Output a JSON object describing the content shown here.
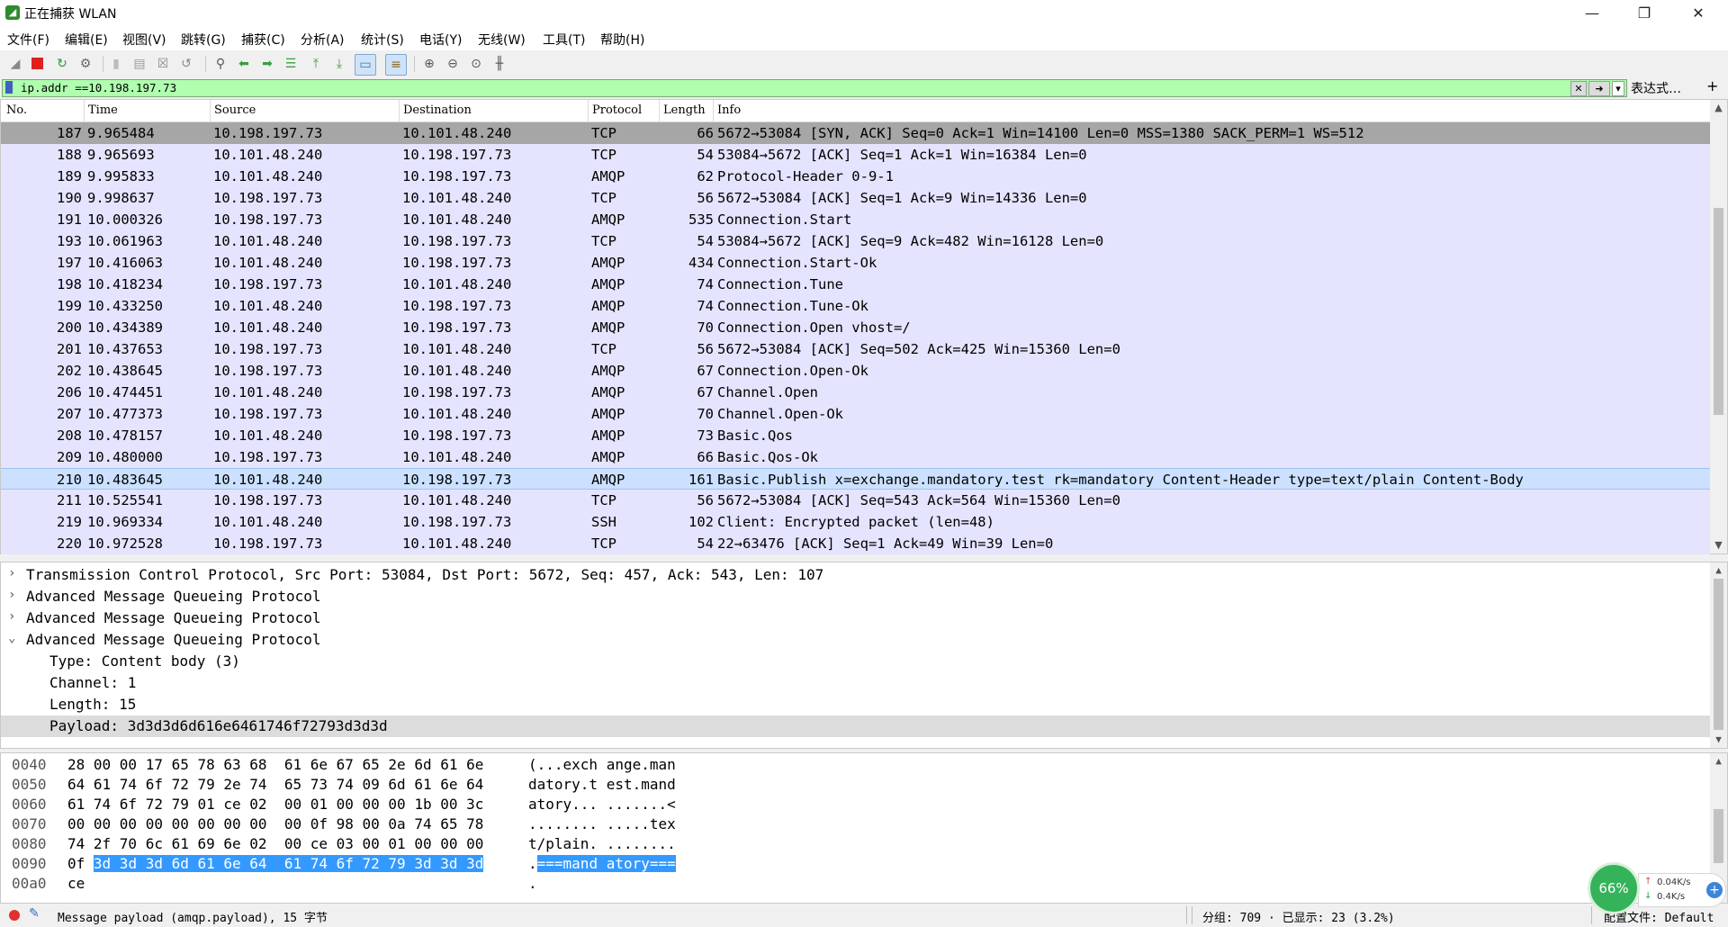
{
  "window": {
    "title": "正在捕获 WLAN",
    "icon": "shark-fin-icon"
  },
  "menu": [
    "文件(F)",
    "编辑(E)",
    "视图(V)",
    "跳转(G)",
    "捕获(C)",
    "分析(A)",
    "统计(S)",
    "电话(Y)",
    "无线(W)",
    "工具(T)",
    "帮助(H)"
  ],
  "filter": {
    "value": "ip.addr ==10.198.197.73",
    "expression_label": "表达式…",
    "add_label": "+"
  },
  "columns": {
    "no": "No.",
    "time": "Time",
    "source": "Source",
    "destination": "Destination",
    "protocol": "Protocol",
    "length": "Length",
    "info": "Info"
  },
  "packets": [
    {
      "no": "187",
      "time": "9.965484",
      "src": "10.198.197.73",
      "dst": "10.101.48.240",
      "proto": "TCP",
      "len": "66",
      "info": "5672→53084 [SYN, ACK] Seq=0 Ack=1 Win=14100 Len=0 MSS=1380 SACK_PERM=1 WS=512"
    },
    {
      "no": "188",
      "time": "9.965693",
      "src": "10.101.48.240",
      "dst": "10.198.197.73",
      "proto": "TCP",
      "len": "54",
      "info": "53084→5672 [ACK] Seq=1 Ack=1 Win=16384 Len=0"
    },
    {
      "no": "189",
      "time": "9.995833",
      "src": "10.101.48.240",
      "dst": "10.198.197.73",
      "proto": "AMQP",
      "len": "62",
      "info": "Protocol-Header 0-9-1"
    },
    {
      "no": "190",
      "time": "9.998637",
      "src": "10.198.197.73",
      "dst": "10.101.48.240",
      "proto": "TCP",
      "len": "56",
      "info": "5672→53084 [ACK] Seq=1 Ack=9 Win=14336 Len=0"
    },
    {
      "no": "191",
      "time": "10.000326",
      "src": "10.198.197.73",
      "dst": "10.101.48.240",
      "proto": "AMQP",
      "len": "535",
      "info": "Connection.Start"
    },
    {
      "no": "193",
      "time": "10.061963",
      "src": "10.101.48.240",
      "dst": "10.198.197.73",
      "proto": "TCP",
      "len": "54",
      "info": "53084→5672 [ACK] Seq=9 Ack=482 Win=16128 Len=0"
    },
    {
      "no": "197",
      "time": "10.416063",
      "src": "10.101.48.240",
      "dst": "10.198.197.73",
      "proto": "AMQP",
      "len": "434",
      "info": "Connection.Start-Ok"
    },
    {
      "no": "198",
      "time": "10.418234",
      "src": "10.198.197.73",
      "dst": "10.101.48.240",
      "proto": "AMQP",
      "len": "74",
      "info": "Connection.Tune"
    },
    {
      "no": "199",
      "time": "10.433250",
      "src": "10.101.48.240",
      "dst": "10.198.197.73",
      "proto": "AMQP",
      "len": "74",
      "info": "Connection.Tune-Ok"
    },
    {
      "no": "200",
      "time": "10.434389",
      "src": "10.101.48.240",
      "dst": "10.198.197.73",
      "proto": "AMQP",
      "len": "70",
      "info": "Connection.Open vhost=/"
    },
    {
      "no": "201",
      "time": "10.437653",
      "src": "10.198.197.73",
      "dst": "10.101.48.240",
      "proto": "TCP",
      "len": "56",
      "info": "5672→53084 [ACK] Seq=502 Ack=425 Win=15360 Len=0"
    },
    {
      "no": "202",
      "time": "10.438645",
      "src": "10.198.197.73",
      "dst": "10.101.48.240",
      "proto": "AMQP",
      "len": "67",
      "info": "Connection.Open-Ok"
    },
    {
      "no": "206",
      "time": "10.474451",
      "src": "10.101.48.240",
      "dst": "10.198.197.73",
      "proto": "AMQP",
      "len": "67",
      "info": "Channel.Open"
    },
    {
      "no": "207",
      "time": "10.477373",
      "src": "10.198.197.73",
      "dst": "10.101.48.240",
      "proto": "AMQP",
      "len": "70",
      "info": "Channel.Open-Ok"
    },
    {
      "no": "208",
      "time": "10.478157",
      "src": "10.101.48.240",
      "dst": "10.198.197.73",
      "proto": "AMQP",
      "len": "73",
      "info": "Basic.Qos"
    },
    {
      "no": "209",
      "time": "10.480000",
      "src": "10.198.197.73",
      "dst": "10.101.48.240",
      "proto": "AMQP",
      "len": "66",
      "info": "Basic.Qos-Ok"
    },
    {
      "no": "210",
      "time": "10.483645",
      "src": "10.101.48.240",
      "dst": "10.198.197.73",
      "proto": "AMQP",
      "len": "161",
      "info": "Basic.Publish x=exchange.mandatory.test rk=mandatory Content-Header type=text/plain Content-Body"
    },
    {
      "no": "211",
      "time": "10.525541",
      "src": "10.198.197.73",
      "dst": "10.101.48.240",
      "proto": "TCP",
      "len": "56",
      "info": "5672→53084 [ACK] Seq=543 Ack=564 Win=15360 Len=0"
    },
    {
      "no": "219",
      "time": "10.969334",
      "src": "10.101.48.240",
      "dst": "10.198.197.73",
      "proto": "SSH",
      "len": "102",
      "info": "Client: Encrypted packet (len=48)"
    },
    {
      "no": "220",
      "time": "10.972528",
      "src": "10.198.197.73",
      "dst": "10.101.48.240",
      "proto": "TCP",
      "len": "54",
      "info": "22→63476 [ACK] Seq=1 Ack=49 Win=39 Len=0"
    }
  ],
  "details": [
    {
      "text": "Transmission Control Protocol, Src Port: 53084, Dst Port: 5672, Seq: 457, Ack: 543, Len: 107",
      "chevron": "›"
    },
    {
      "text": "Advanced Message Queueing Protocol",
      "chevron": "›"
    },
    {
      "text": "Advanced Message Queueing Protocol",
      "chevron": "›"
    },
    {
      "text": "Advanced Message Queueing Protocol",
      "chevron": "⌄"
    },
    {
      "text": "Type: Content body (3)",
      "chevron": ""
    },
    {
      "text": "Channel: 1",
      "chevron": ""
    },
    {
      "text": "Length: 15",
      "chevron": ""
    },
    {
      "text": "Payload: 3d3d3d6d616e6461746f72793d3d3d",
      "chevron": ""
    }
  ],
  "bytes": [
    {
      "offset": "0040",
      "hex": "28 00 00 17 65 78 63 68  61 6e 67 65 2e 6d 61 6e",
      "hex_hl": "",
      "ascii": "(...exch ange.man",
      "ascii_hl": ""
    },
    {
      "offset": "0050",
      "hex": "64 61 74 6f 72 79 2e 74  65 73 74 09 6d 61 6e 64",
      "hex_hl": "",
      "ascii": "datory.t est.mand",
      "ascii_hl": ""
    },
    {
      "offset": "0060",
      "hex": "61 74 6f 72 79 01 ce 02  00 01 00 00 00 1b 00 3c",
      "hex_hl": "",
      "ascii": "atory... .......<",
      "ascii_hl": ""
    },
    {
      "offset": "0070",
      "hex": "00 00 00 00 00 00 00 00  00 0f 98 00 0a 74 65 78",
      "hex_hl": "",
      "ascii": "........ .....tex",
      "ascii_hl": ""
    },
    {
      "offset": "0080",
      "hex": "74 2f 70 6c 61 69 6e 02  00 ce 03 00 01 00 00 00",
      "hex_hl": "",
      "ascii": "t/plain. ........",
      "ascii_hl": ""
    },
    {
      "offset": "0090",
      "hex": "0f ",
      "hex_hl": "3d 3d 3d 6d 61 6e 64  61 74 6f 72 79 3d 3d 3d",
      "ascii": ".",
      "ascii_hl": "===mand atory==="
    },
    {
      "offset": "00a0",
      "hex": "ce",
      "hex_hl": "",
      "ascii": ".",
      "ascii_hl": ""
    }
  ],
  "status": {
    "field": "Message payload (amqp.payload), 15 字节",
    "packets": "分组: 709 · 已显示: 23 (3.2%)",
    "profile": "配置文件: Default"
  },
  "speed": {
    "percent": "66%",
    "up": "0.04K/s",
    "down": "0.4K/s"
  },
  "colors": {
    "row_bg": "#e4e4ff",
    "selected_row": "#a6a6a6",
    "highlight_row": "#cce1ff",
    "filter_ok": "#afffaf",
    "byte_highlight": "#3399ff"
  }
}
